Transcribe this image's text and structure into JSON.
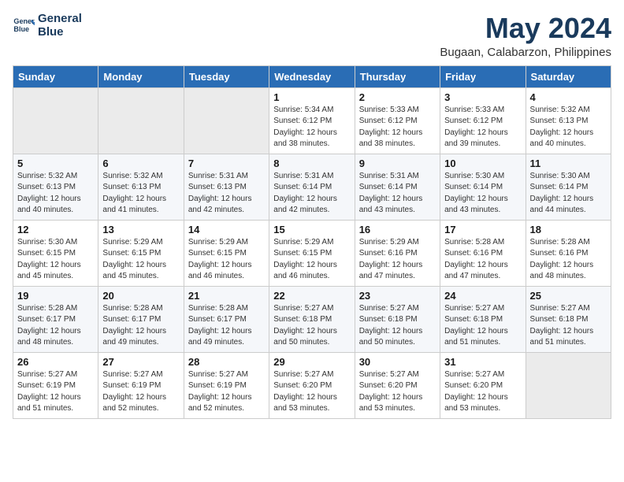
{
  "header": {
    "logo_line1": "General",
    "logo_line2": "Blue",
    "month_year": "May 2024",
    "location": "Bugaan, Calabarzon, Philippines"
  },
  "weekdays": [
    "Sunday",
    "Monday",
    "Tuesday",
    "Wednesday",
    "Thursday",
    "Friday",
    "Saturday"
  ],
  "weeks": [
    [
      {
        "day": "",
        "info": ""
      },
      {
        "day": "",
        "info": ""
      },
      {
        "day": "",
        "info": ""
      },
      {
        "day": "1",
        "info": "Sunrise: 5:34 AM\nSunset: 6:12 PM\nDaylight: 12 hours\nand 38 minutes."
      },
      {
        "day": "2",
        "info": "Sunrise: 5:33 AM\nSunset: 6:12 PM\nDaylight: 12 hours\nand 38 minutes."
      },
      {
        "day": "3",
        "info": "Sunrise: 5:33 AM\nSunset: 6:12 PM\nDaylight: 12 hours\nand 39 minutes."
      },
      {
        "day": "4",
        "info": "Sunrise: 5:32 AM\nSunset: 6:13 PM\nDaylight: 12 hours\nand 40 minutes."
      }
    ],
    [
      {
        "day": "5",
        "info": "Sunrise: 5:32 AM\nSunset: 6:13 PM\nDaylight: 12 hours\nand 40 minutes."
      },
      {
        "day": "6",
        "info": "Sunrise: 5:32 AM\nSunset: 6:13 PM\nDaylight: 12 hours\nand 41 minutes."
      },
      {
        "day": "7",
        "info": "Sunrise: 5:31 AM\nSunset: 6:13 PM\nDaylight: 12 hours\nand 42 minutes."
      },
      {
        "day": "8",
        "info": "Sunrise: 5:31 AM\nSunset: 6:14 PM\nDaylight: 12 hours\nand 42 minutes."
      },
      {
        "day": "9",
        "info": "Sunrise: 5:31 AM\nSunset: 6:14 PM\nDaylight: 12 hours\nand 43 minutes."
      },
      {
        "day": "10",
        "info": "Sunrise: 5:30 AM\nSunset: 6:14 PM\nDaylight: 12 hours\nand 43 minutes."
      },
      {
        "day": "11",
        "info": "Sunrise: 5:30 AM\nSunset: 6:14 PM\nDaylight: 12 hours\nand 44 minutes."
      }
    ],
    [
      {
        "day": "12",
        "info": "Sunrise: 5:30 AM\nSunset: 6:15 PM\nDaylight: 12 hours\nand 45 minutes."
      },
      {
        "day": "13",
        "info": "Sunrise: 5:29 AM\nSunset: 6:15 PM\nDaylight: 12 hours\nand 45 minutes."
      },
      {
        "day": "14",
        "info": "Sunrise: 5:29 AM\nSunset: 6:15 PM\nDaylight: 12 hours\nand 46 minutes."
      },
      {
        "day": "15",
        "info": "Sunrise: 5:29 AM\nSunset: 6:15 PM\nDaylight: 12 hours\nand 46 minutes."
      },
      {
        "day": "16",
        "info": "Sunrise: 5:29 AM\nSunset: 6:16 PM\nDaylight: 12 hours\nand 47 minutes."
      },
      {
        "day": "17",
        "info": "Sunrise: 5:28 AM\nSunset: 6:16 PM\nDaylight: 12 hours\nand 47 minutes."
      },
      {
        "day": "18",
        "info": "Sunrise: 5:28 AM\nSunset: 6:16 PM\nDaylight: 12 hours\nand 48 minutes."
      }
    ],
    [
      {
        "day": "19",
        "info": "Sunrise: 5:28 AM\nSunset: 6:17 PM\nDaylight: 12 hours\nand 48 minutes."
      },
      {
        "day": "20",
        "info": "Sunrise: 5:28 AM\nSunset: 6:17 PM\nDaylight: 12 hours\nand 49 minutes."
      },
      {
        "day": "21",
        "info": "Sunrise: 5:28 AM\nSunset: 6:17 PM\nDaylight: 12 hours\nand 49 minutes."
      },
      {
        "day": "22",
        "info": "Sunrise: 5:27 AM\nSunset: 6:18 PM\nDaylight: 12 hours\nand 50 minutes."
      },
      {
        "day": "23",
        "info": "Sunrise: 5:27 AM\nSunset: 6:18 PM\nDaylight: 12 hours\nand 50 minutes."
      },
      {
        "day": "24",
        "info": "Sunrise: 5:27 AM\nSunset: 6:18 PM\nDaylight: 12 hours\nand 51 minutes."
      },
      {
        "day": "25",
        "info": "Sunrise: 5:27 AM\nSunset: 6:18 PM\nDaylight: 12 hours\nand 51 minutes."
      }
    ],
    [
      {
        "day": "26",
        "info": "Sunrise: 5:27 AM\nSunset: 6:19 PM\nDaylight: 12 hours\nand 51 minutes."
      },
      {
        "day": "27",
        "info": "Sunrise: 5:27 AM\nSunset: 6:19 PM\nDaylight: 12 hours\nand 52 minutes."
      },
      {
        "day": "28",
        "info": "Sunrise: 5:27 AM\nSunset: 6:19 PM\nDaylight: 12 hours\nand 52 minutes."
      },
      {
        "day": "29",
        "info": "Sunrise: 5:27 AM\nSunset: 6:20 PM\nDaylight: 12 hours\nand 53 minutes."
      },
      {
        "day": "30",
        "info": "Sunrise: 5:27 AM\nSunset: 6:20 PM\nDaylight: 12 hours\nand 53 minutes."
      },
      {
        "day": "31",
        "info": "Sunrise: 5:27 AM\nSunset: 6:20 PM\nDaylight: 12 hours\nand 53 minutes."
      },
      {
        "day": "",
        "info": ""
      }
    ]
  ]
}
